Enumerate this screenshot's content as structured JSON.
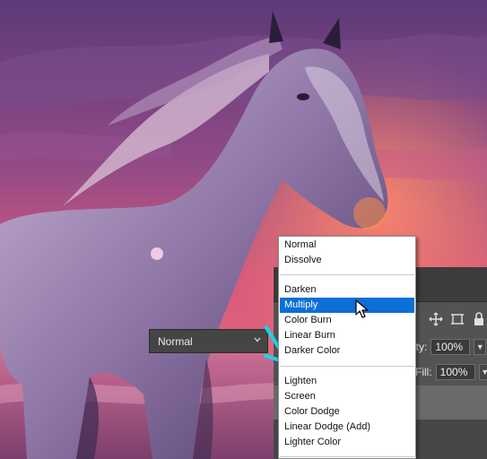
{
  "layers_panel": {
    "blend_mode_value": "Normal",
    "opacity_label": "city:",
    "opacity_value": "100%",
    "fill_label": "Fill:",
    "fill_value": "100%"
  },
  "blend_menu": {
    "items": [
      {
        "label": "Normal"
      },
      {
        "label": "Dissolve"
      },
      {
        "label": "Darken"
      },
      {
        "label": "Multiply"
      },
      {
        "label": "Color Burn"
      },
      {
        "label": "Linear Burn"
      },
      {
        "label": "Darker Color"
      },
      {
        "label": "Lighten"
      },
      {
        "label": "Screen"
      },
      {
        "label": "Color Dodge"
      },
      {
        "label": "Linear Dodge (Add)"
      },
      {
        "label": "Lighter Color"
      }
    ],
    "selected": "Multiply"
  },
  "colors": {
    "menu_highlight": "#0b6fd6",
    "callout": "#19d6e6",
    "panel_bg": "#535353"
  }
}
